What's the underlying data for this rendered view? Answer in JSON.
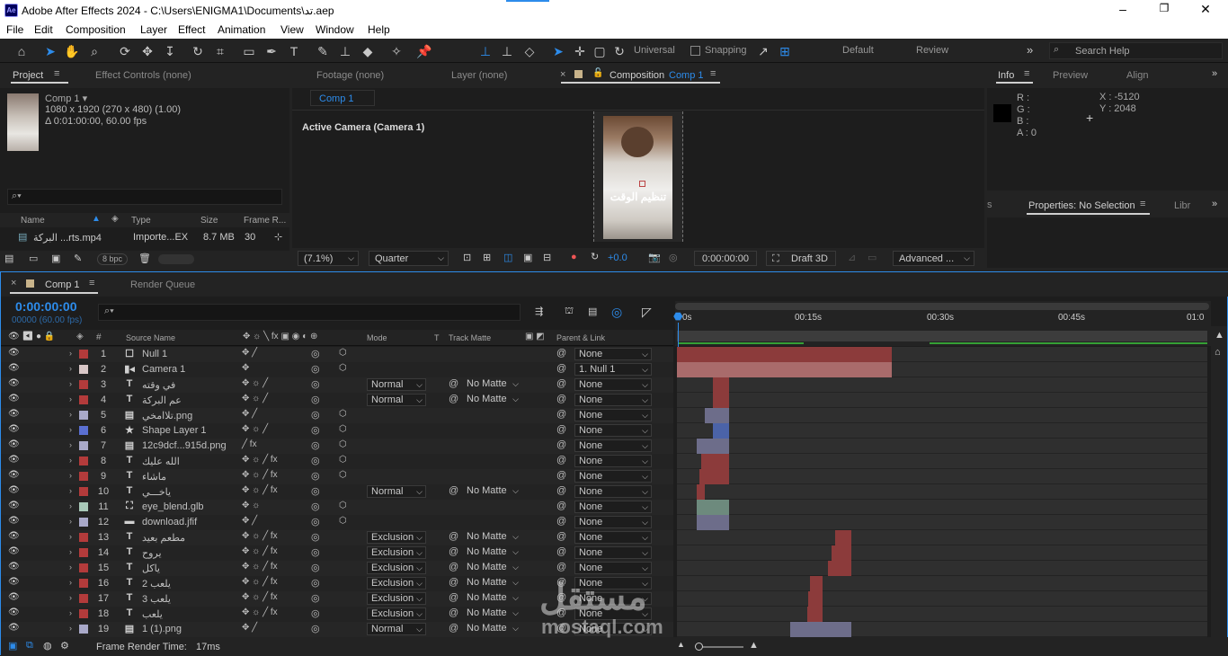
{
  "window": {
    "title": "Adobe After Effects 2024 - C:\\Users\\ENIGMA1\\Documents\\تد.aep",
    "logo": "Ae"
  },
  "menu": [
    "File",
    "Edit",
    "Composition",
    "Layer",
    "Effect",
    "Animation",
    "View",
    "Window",
    "Help"
  ],
  "toolbar": {
    "universal": "Universal",
    "snapping": "Snapping",
    "workspaces": [
      "Default",
      "Review"
    ],
    "search_placeholder": "Search Help"
  },
  "project": {
    "tab": "Project",
    "effect_controls": "Effect Controls (none)",
    "comp_name": "Comp 1 ▾",
    "comp_info1": "1080 x 1920  (270 x 480) (1.00)",
    "comp_info2": "Δ 0:01:00:00, 60.00 fps",
    "columns": [
      "Name",
      "Type",
      "Size",
      "Frame R..."
    ],
    "item": {
      "name": "البركة ...rts.mp4",
      "type": "Importe...EX",
      "size": "8.7 MB",
      "rate": "30"
    },
    "bpc": "8 bpc"
  },
  "viewer": {
    "tabs": [
      "Footage (none)",
      "Layer (none)"
    ],
    "comp_tab": "Composition",
    "comp_tab_name": "Comp 1",
    "breadcrumb": "Comp 1",
    "camera": "Active Camera (Camera 1)",
    "overlay_text": "تنظيم الوقت",
    "zoom": "(7.1%)",
    "resolution": "Quarter",
    "exposure": "+0.0",
    "time": "0:00:00:00",
    "renderer": "Draft 3D",
    "advanced": "Advanced ..."
  },
  "info": {
    "tabs": [
      "Info",
      "Preview",
      "Align"
    ],
    "r": "R :",
    "g": "G :",
    "b": "B :",
    "a": "A :  0",
    "x": "X : -5120",
    "y": "Y :  2048",
    "props": "Properties: No Selection",
    "libr": "Libr"
  },
  "timeline": {
    "tab": "Comp 1",
    "render_queue": "Render Queue",
    "timecode": "0:00:00:00",
    "frames": "00000 (60.00 fps)",
    "ruler": [
      "0s",
      "00:15s",
      "00:30s",
      "00:45s",
      "01:0"
    ],
    "columns": {
      "source": "Source Name",
      "mode": "Mode",
      "t": "T",
      "trackmatte": "Track Matte",
      "parent": "Parent & Link"
    },
    "frame_render_label": "Frame Render Time:",
    "frame_render_value": "17ms",
    "layers": [
      {
        "n": "1",
        "name": "Null 1",
        "icon": "null-icon",
        "label": "#b33b3b",
        "mode": "",
        "matte": "",
        "parent": "None",
        "sw": "✥   ╱",
        "bar": [
          0,
          0.405
        ],
        "bar_color": "#8c3b3b"
      },
      {
        "n": "2",
        "name": "Camera 1",
        "icon": "camera-icon",
        "label": "#d9c7c7",
        "mode": "",
        "matte": "",
        "parent": "1. Null 1",
        "sw": "✥",
        "bar": [
          0,
          0.405
        ],
        "bar_color": "#a96b6b"
      },
      {
        "n": "3",
        "name": "في وقته",
        "icon": "text-icon",
        "label": "#b33b3b",
        "mode": "Normal",
        "matte": "No Matte",
        "parent": "None",
        "sw": "✥ ☼ ╱",
        "bar": [
          0.068,
          0.098
        ],
        "bar_color": "#8c3b3b"
      },
      {
        "n": "4",
        "name": "عم البركة",
        "icon": "text-icon",
        "label": "#b33b3b",
        "mode": "Normal",
        "matte": "No Matte",
        "parent": "None",
        "sw": "✥ ☼ ╱",
        "bar": [
          0.068,
          0.098
        ],
        "bar_color": "#8c3b3b"
      },
      {
        "n": "5",
        "name": "تلاامخي.png",
        "icon": "file-icon",
        "label": "#a9a9c9",
        "mode": "",
        "matte": "",
        "parent": "None",
        "sw": "✥   ╱",
        "bar": [
          0.053,
          0.098
        ],
        "bar_color": "#6d6d8a"
      },
      {
        "n": "6",
        "name": "Shape Layer 1",
        "icon": "star-icon",
        "label": "#5a6fd1",
        "mode": "",
        "matte": "",
        "parent": "None",
        "sw": "✥ ☼ ╱",
        "bar": [
          0.068,
          0.098
        ],
        "bar_color": "#4b63a8"
      },
      {
        "n": "7",
        "name": "12c9dcf...915d.png",
        "icon": "file-icon",
        "label": "#a9a9c9",
        "mode": "",
        "matte": "",
        "parent": "None",
        "sw": "    ╱ fx",
        "bar": [
          0.038,
          0.098
        ],
        "bar_color": "#6d6d8a"
      },
      {
        "n": "8",
        "name": "الله عليك",
        "icon": "text-icon",
        "label": "#b33b3b",
        "mode": "",
        "matte": "",
        "parent": "None",
        "sw": "✥ ☼ ╱ fx",
        "bar": [
          0.045,
          0.098
        ],
        "bar_color": "#8c3b3b"
      },
      {
        "n": "9",
        "name": "ماشاء",
        "icon": "text-icon",
        "label": "#b33b3b",
        "mode": "",
        "matte": "",
        "parent": "None",
        "sw": "✥ ☼ ╱ fx",
        "bar": [
          0.042,
          0.098
        ],
        "bar_color": "#8c3b3b"
      },
      {
        "n": "10",
        "name": "ياخـــي",
        "icon": "text-icon",
        "label": "#b33b3b",
        "mode": "Normal",
        "matte": "No Matte",
        "parent": "None",
        "sw": "✥ ☼ ╱ fx",
        "bar": [
          0.038,
          0.053
        ],
        "bar_color": "#8c3b3b"
      },
      {
        "n": "11",
        "name": "eye_blend.glb",
        "icon": "3d-icon",
        "label": "#a9c9b9",
        "mode": "",
        "matte": "",
        "parent": "None",
        "sw": "✥ ☼",
        "bar": [
          0.038,
          0.098
        ],
        "bar_color": "#6d8a7d"
      },
      {
        "n": "12",
        "name": "download.jfif",
        "icon": "image-icon",
        "label": "#a9a9c9",
        "mode": "",
        "matte": "",
        "parent": "None",
        "sw": "✥   ╱",
        "bar": [
          0.038,
          0.098
        ],
        "bar_color": "#6d6d8a"
      },
      {
        "n": "13",
        "name": "مطعم بعيد",
        "icon": "text-icon",
        "label": "#b33b3b",
        "mode": "Exclusion",
        "matte": "No Matte",
        "parent": "None",
        "sw": "✥ ☼ ╱ fx",
        "bar": [
          0.298,
          0.328
        ],
        "bar_color": "#8c3b3b"
      },
      {
        "n": "14",
        "name": "يروح",
        "icon": "text-icon",
        "label": "#b33b3b",
        "mode": "Exclusion",
        "matte": "No Matte",
        "parent": "None",
        "sw": "✥ ☼ ╱ fx",
        "bar": [
          0.292,
          0.328
        ],
        "bar_color": "#8c3b3b"
      },
      {
        "n": "15",
        "name": "ياكل",
        "icon": "text-icon",
        "label": "#b33b3b",
        "mode": "Exclusion",
        "matte": "No Matte",
        "parent": "None",
        "sw": "✥ ☼ ╱ fx",
        "bar": [
          0.285,
          0.328
        ],
        "bar_color": "#8c3b3b"
      },
      {
        "n": "16",
        "name": "يلعب 2",
        "icon": "text-icon",
        "label": "#b33b3b",
        "mode": "Exclusion",
        "matte": "No Matte",
        "parent": "None",
        "sw": "✥ ☼ ╱ fx",
        "bar": [
          0.25,
          0.275
        ],
        "bar_color": "#8c3b3b"
      },
      {
        "n": "17",
        "name": "يلعب 3",
        "icon": "text-icon",
        "label": "#b33b3b",
        "mode": "Exclusion",
        "matte": "No Matte",
        "parent": "None",
        "sw": "✥ ☼ ╱ fx",
        "bar": [
          0.248,
          0.275
        ],
        "bar_color": "#8c3b3b"
      },
      {
        "n": "18",
        "name": "يلعب",
        "icon": "text-icon",
        "label": "#b33b3b",
        "mode": "Exclusion",
        "matte": "No Matte",
        "parent": "None",
        "sw": "✥ ☼ ╱ fx",
        "bar": [
          0.245,
          0.275
        ],
        "bar_color": "#8c3b3b"
      },
      {
        "n": "19",
        "name": "1 (1).png",
        "icon": "file-icon",
        "label": "#a9a9c9",
        "mode": "Normal",
        "matte": "No Matte",
        "parent": "None",
        "sw": "✥   ╱",
        "bar": [
          0.213,
          0.328
        ],
        "bar_color": "#6d6d8a"
      }
    ]
  },
  "watermark": {
    "arabic": "مستقل",
    "latin": "mostaql.com"
  }
}
